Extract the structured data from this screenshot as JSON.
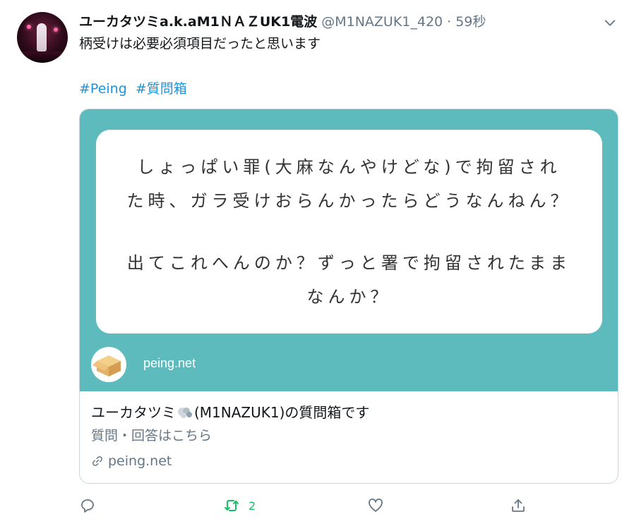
{
  "author": {
    "display_name": "ユーカタツミa.k.aM1ＮＡＺUK1電波",
    "handle": "@M1NAZUK1_420",
    "separator": "·",
    "time": "59秒"
  },
  "tweet": {
    "text": "柄受けは必要必須項目だったと思います",
    "hashtags": [
      "#Peing",
      "#質問箱"
    ]
  },
  "card": {
    "question_lines_1": [
      "しょっぱい罪(大麻なんやけどな)で拘留され",
      "た時、ガラ受けおらんかったらどうなんねん？"
    ],
    "question_lines_2": [
      "出てこれへんのか？ずっと署で拘留されたまま",
      "なんか？"
    ],
    "site_label": "peing.net",
    "title_prefix": "ユーカタツミ",
    "title_suffix": "(M1NAZUK1)の質問箱です",
    "description": "質問・回答はこちら",
    "link": "peing.net",
    "colors": {
      "background": "#5ebbbd",
      "box": "#ffffff"
    }
  },
  "actions": {
    "reply_icon": "reply-icon",
    "retweet_icon": "retweet-icon",
    "retweet_count": "2",
    "like_icon": "heart-icon",
    "share_icon": "share-icon"
  },
  "colors": {
    "link": "#1b95e0",
    "secondary_text": "#657786",
    "retweet": "#17bf63"
  }
}
